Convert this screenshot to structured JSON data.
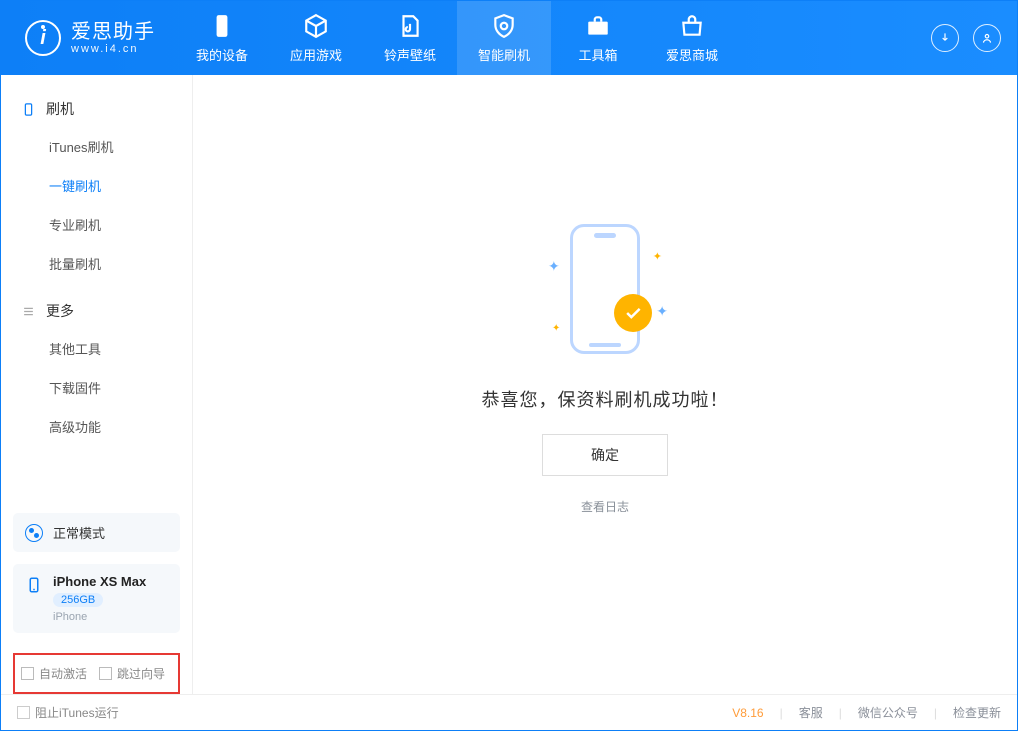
{
  "brand": {
    "name": "爱思助手",
    "url": "www.i4.cn"
  },
  "nav": [
    {
      "label": "我的设备"
    },
    {
      "label": "应用游戏"
    },
    {
      "label": "铃声壁纸"
    },
    {
      "label": "智能刷机"
    },
    {
      "label": "工具箱"
    },
    {
      "label": "爱思商城"
    }
  ],
  "sidebar": {
    "section1": {
      "title": "刷机"
    },
    "items1": [
      {
        "label": "iTunes刷机"
      },
      {
        "label": "一键刷机"
      },
      {
        "label": "专业刷机"
      },
      {
        "label": "批量刷机"
      }
    ],
    "section2": {
      "title": "更多"
    },
    "items2": [
      {
        "label": "其他工具"
      },
      {
        "label": "下载固件"
      },
      {
        "label": "高级功能"
      }
    ]
  },
  "mode": {
    "label": "正常模式"
  },
  "device": {
    "name": "iPhone XS Max",
    "capacity": "256GB",
    "type": "iPhone"
  },
  "options": {
    "auto_activate": "自动激活",
    "skip_guide": "跳过向导"
  },
  "main": {
    "success_text": "恭喜您，保资料刷机成功啦！",
    "confirm_label": "确定",
    "view_log": "查看日志"
  },
  "footer": {
    "block_itunes": "阻止iTunes运行",
    "version": "V8.16",
    "support": "客服",
    "wechat": "微信公众号",
    "update": "检查更新"
  }
}
